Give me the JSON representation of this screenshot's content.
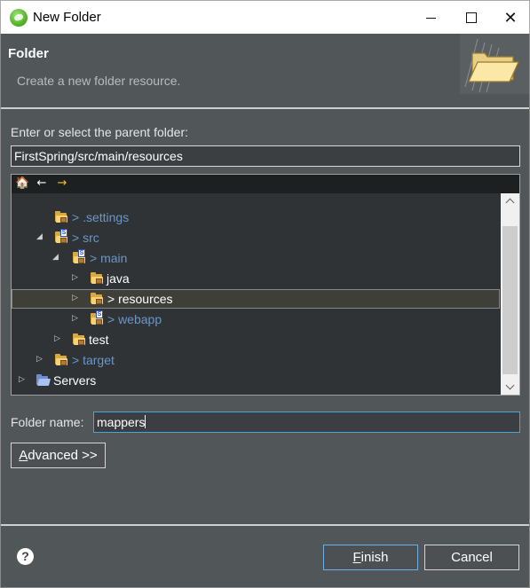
{
  "window": {
    "title": "New Folder",
    "minimize_label": "",
    "maximize_label": "",
    "close_label": "✕"
  },
  "header": {
    "title": "Folder",
    "description": "Create a new folder resource."
  },
  "parent": {
    "label": "Enter or select the parent folder:",
    "path": "FirstSpring/src/main/resources"
  },
  "tree_toolbar": {
    "home_icon": "🏠",
    "back_icon": "←",
    "forward_icon": "→"
  },
  "tree": {
    "rows": [
      {
        "twisty": "",
        "label": "> .settings",
        "style": "blue",
        "icon": "folder-icon"
      },
      {
        "twisty": "◢",
        "label": "> src",
        "style": "blue",
        "icon": "source-folder-icon"
      },
      {
        "twisty": "◢",
        "label": "> main",
        "style": "blue",
        "icon": "source-folder-icon"
      },
      {
        "twisty": "▷",
        "label": "java",
        "style": "white",
        "icon": "folder-icon"
      },
      {
        "twisty": "▷",
        "label": "> resources",
        "style": "white",
        "icon": "folder-icon",
        "selected": true
      },
      {
        "twisty": "▷",
        "label": "> webapp",
        "style": "blue",
        "icon": "source-folder-icon"
      },
      {
        "twisty": "▷",
        "label": "test",
        "style": "white",
        "icon": "folder-icon"
      },
      {
        "twisty": "▷",
        "label": "> target",
        "style": "blue",
        "icon": "folder-icon"
      },
      {
        "twisty": "▷",
        "label": "Servers",
        "style": "white",
        "icon": "open-folder-icon"
      }
    ]
  },
  "folder_name": {
    "label": "Folder name:",
    "value": "mappers"
  },
  "advanced_button": {
    "accel": "A",
    "rest": "dvanced >>"
  },
  "footer": {
    "help_icon": "?",
    "finish_accel": "F",
    "finish_rest": "inish",
    "cancel": "Cancel"
  },
  "colors": {
    "dialog_bg": "#515658",
    "tree_bg": "#2f3335",
    "link_blue": "#6b96c8",
    "focus_border": "#4ea2d8"
  }
}
